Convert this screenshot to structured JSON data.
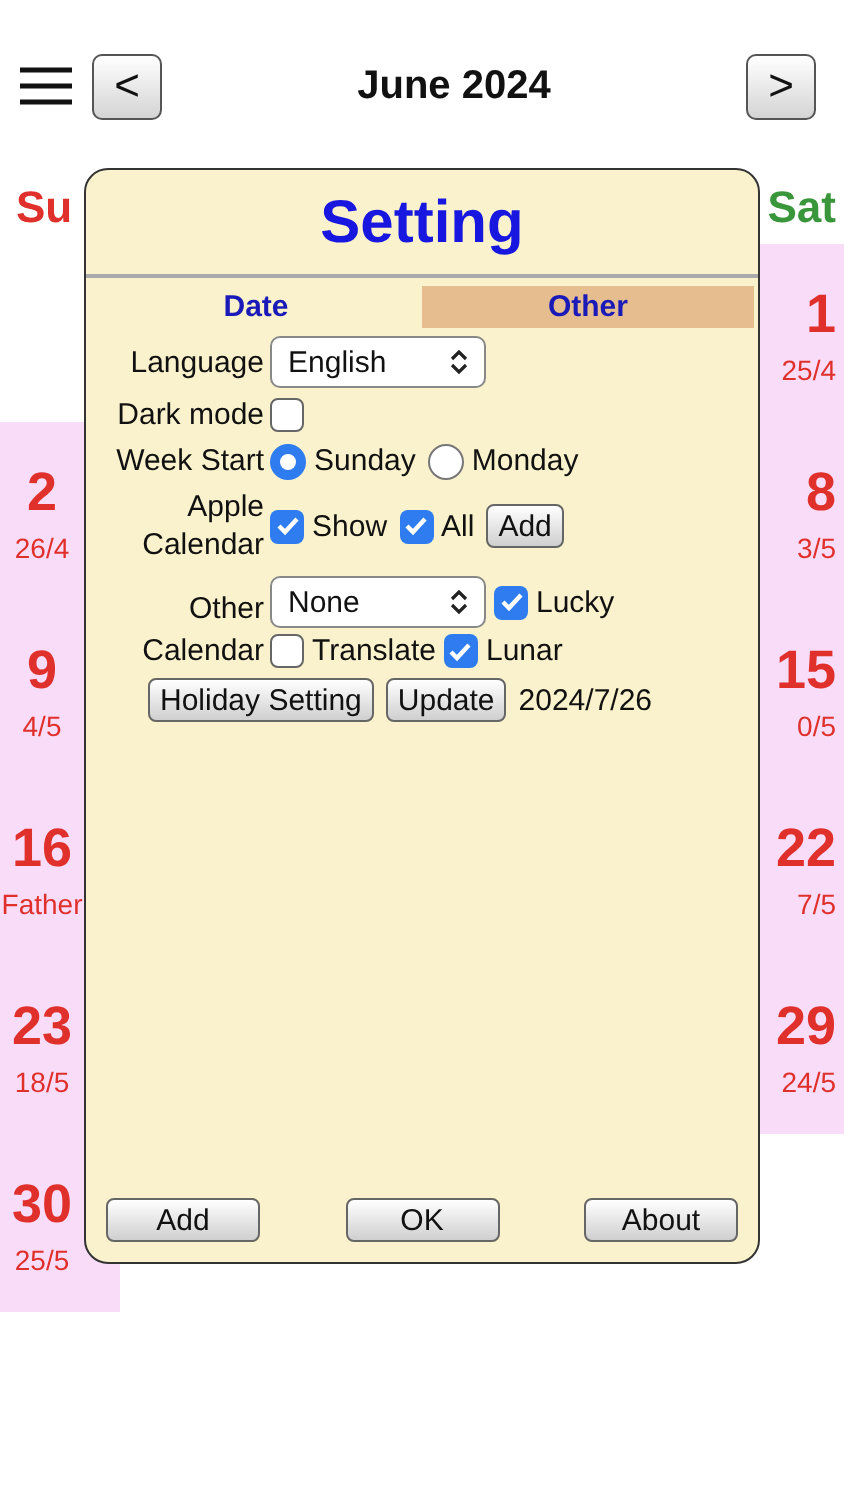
{
  "header": {
    "prev": "<",
    "title": "June 2024",
    "next": ">"
  },
  "calendar": {
    "sunday": {
      "heading": "Su",
      "days": [
        {
          "day": "2",
          "note": "26/4"
        },
        {
          "day": "9",
          "note": "4/5"
        },
        {
          "day": "16",
          "note": "Father"
        },
        {
          "day": "23",
          "note": "18/5"
        },
        {
          "day": "30",
          "note": "25/5"
        }
      ]
    },
    "saturday": {
      "heading": "Sat",
      "days": [
        {
          "day": "1",
          "note": "25/4"
        },
        {
          "day": "8",
          "note": "3/5"
        },
        {
          "day": "15",
          "note": "0/5"
        },
        {
          "day": "22",
          "note": "7/5"
        },
        {
          "day": "29",
          "note": "24/5"
        }
      ]
    }
  },
  "dialog": {
    "title": "Setting",
    "tabs": [
      {
        "label": "Date",
        "selected": true
      },
      {
        "label": "Other",
        "selected": false
      }
    ],
    "language": {
      "label": "Language",
      "value": "English"
    },
    "dark_mode": {
      "label": "Dark mode",
      "checked": false
    },
    "week_start": {
      "label": "Week Start",
      "options": [
        {
          "label": "Sunday",
          "selected": true
        },
        {
          "label": "Monday",
          "selected": false
        }
      ]
    },
    "apple_calendar": {
      "label": "Apple Calendar",
      "checks": [
        {
          "label": "Show",
          "checked": true
        },
        {
          "label": "All",
          "checked": true
        }
      ],
      "button": "Add"
    },
    "other_calendar": {
      "label_lines": [
        "Other",
        "Calendar"
      ],
      "value": "None",
      "checks": [
        {
          "label": "Lucky",
          "checked": true
        },
        {
          "label": "Translate",
          "checked": false
        },
        {
          "label": "Lunar",
          "checked": true
        }
      ]
    },
    "actions": {
      "buttons": [
        "Holiday Setting",
        "Update"
      ],
      "date": "2024/7/26"
    },
    "footer": [
      "Add",
      "OK",
      "About"
    ]
  }
}
